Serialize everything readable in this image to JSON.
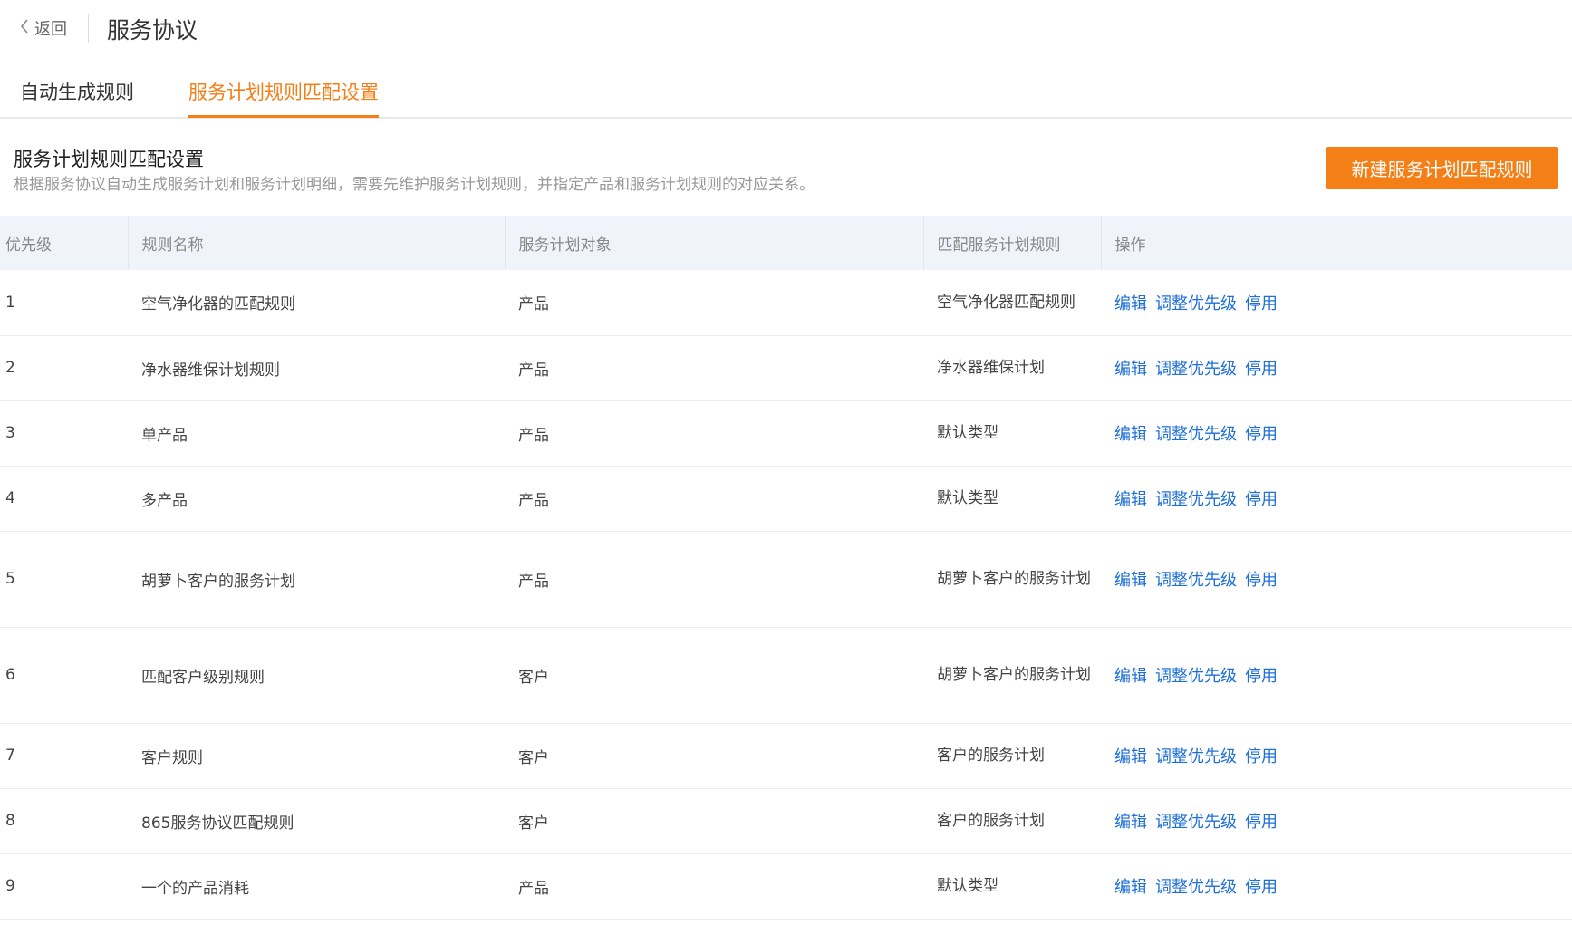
{
  "header": {
    "back_label": "返回",
    "title": "服务协议"
  },
  "tabs": [
    {
      "label": "自动生成规则",
      "active": false
    },
    {
      "label": "服务计划规则匹配设置",
      "active": true
    }
  ],
  "section": {
    "title": "服务计划规则匹配设置",
    "description": "根据服务协议自动生成服务计划和服务计划明细，需要先维护服务计划规则，并指定产品和服务计划规则的对应关系。",
    "new_button_label": "新建服务计划匹配规则"
  },
  "table": {
    "columns": [
      "优先级",
      "规则名称",
      "服务计划对象",
      "匹配服务计划规则",
      "操作"
    ],
    "actions": [
      "编辑",
      "调整优先级",
      "停用"
    ],
    "rows": [
      {
        "priority": "1",
        "name": "空气净化器的匹配规则",
        "object": "产品",
        "rule": "空气净化器匹配规则"
      },
      {
        "priority": "2",
        "name": "净水器维保计划规则",
        "object": "产品",
        "rule": "净水器维保计划"
      },
      {
        "priority": "3",
        "name": "单产品",
        "object": "产品",
        "rule": "默认类型"
      },
      {
        "priority": "4",
        "name": "多产品",
        "object": "产品",
        "rule": "默认类型"
      },
      {
        "priority": "5",
        "name": "胡萝卜客户的服务计划",
        "object": "产品",
        "rule": "胡萝卜客户的服务计划"
      },
      {
        "priority": "6",
        "name": "匹配客户级别规则",
        "object": "客户",
        "rule": "胡萝卜客户的服务计划"
      },
      {
        "priority": "7",
        "name": "客户规则",
        "object": "客户",
        "rule": "客户的服务计划"
      },
      {
        "priority": "8",
        "name": "865服务协议匹配规则",
        "object": "客户",
        "rule": "客户的服务计划"
      },
      {
        "priority": "9",
        "name": "一个的产品消耗",
        "object": "产品",
        "rule": "默认类型"
      }
    ]
  },
  "colors": {
    "accent": "#f57f17",
    "link": "#1e6fd9",
    "header_bg": "#f0f3f9"
  }
}
